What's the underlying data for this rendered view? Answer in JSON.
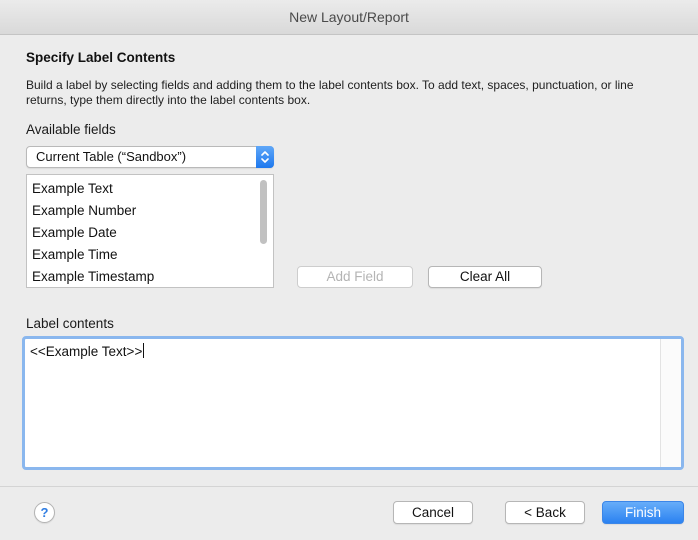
{
  "window": {
    "title": "New Layout/Report"
  },
  "section": {
    "title": "Specify Label Contents",
    "description": "Build a label by selecting fields and adding them to the label contents box. To add text, spaces, punctuation, or line returns, type them directly into the label contents box."
  },
  "available_fields": {
    "label": "Available fields",
    "table_select_value": "Current Table (“Sandbox”)",
    "items": [
      {
        "label": "Example Text"
      },
      {
        "label": "Example Number"
      },
      {
        "label": "Example Date"
      },
      {
        "label": "Example Time"
      },
      {
        "label": "Example Timestamp"
      }
    ]
  },
  "actions": {
    "add_field_label": "Add Field",
    "add_field_enabled": false,
    "clear_all_label": "Clear All"
  },
  "label_contents": {
    "label": "Label contents",
    "value": "<<Example Text>>"
  },
  "footer": {
    "help_label": "?",
    "cancel_label": "Cancel",
    "back_label": "< Back",
    "finish_label": "Finish"
  },
  "colors": {
    "accent": "#2b82f1",
    "focus_ring": "#8ab7ee"
  },
  "icons": {
    "select_stepper": "up-down-chevron-icon",
    "help": "question-mark-icon"
  }
}
